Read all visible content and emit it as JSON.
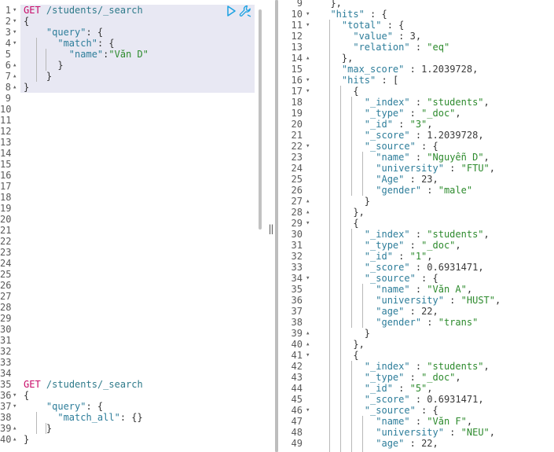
{
  "left_editor": {
    "lines": [
      {
        "n": "1",
        "fold": "▾",
        "parts": [
          [
            "m",
            "GET"
          ],
          [
            "p",
            " "
          ],
          [
            "u",
            "/students/_search"
          ]
        ]
      },
      {
        "n": "2",
        "fold": "▾",
        "parts": [
          [
            "p",
            "{"
          ]
        ]
      },
      {
        "n": "3",
        "fold": "▾",
        "parts": [
          [
            "p",
            "    "
          ],
          [
            "k",
            "\"query\""
          ],
          [
            "p",
            ": {"
          ]
        ]
      },
      {
        "n": "4",
        "fold": "▾",
        "parts": [
          [
            "p",
            "      "
          ],
          [
            "k",
            "\"match\""
          ],
          [
            "p",
            ": {"
          ]
        ]
      },
      {
        "n": "5",
        "fold": "",
        "parts": [
          [
            "p",
            "        "
          ],
          [
            "k",
            "\"name\""
          ],
          [
            "p",
            ":"
          ],
          [
            "s",
            "\"Văn D\""
          ]
        ]
      },
      {
        "n": "6",
        "fold": "▴",
        "parts": [
          [
            "p",
            "      }"
          ]
        ]
      },
      {
        "n": "7",
        "fold": "▴",
        "parts": [
          [
            "p",
            "    }"
          ]
        ]
      },
      {
        "n": "8",
        "fold": "▴",
        "parts": [
          [
            "p",
            "}"
          ]
        ]
      },
      {
        "n": "9",
        "fold": "",
        "parts": []
      },
      {
        "n": "10",
        "fold": "",
        "parts": []
      },
      {
        "n": "11",
        "fold": "",
        "parts": []
      },
      {
        "n": "12",
        "fold": "",
        "parts": []
      },
      {
        "n": "13",
        "fold": "",
        "parts": []
      },
      {
        "n": "14",
        "fold": "",
        "parts": []
      },
      {
        "n": "15",
        "fold": "",
        "parts": []
      },
      {
        "n": "16",
        "fold": "",
        "parts": []
      },
      {
        "n": "17",
        "fold": "",
        "parts": []
      },
      {
        "n": "18",
        "fold": "",
        "parts": []
      },
      {
        "n": "19",
        "fold": "",
        "parts": []
      },
      {
        "n": "20",
        "fold": "",
        "parts": []
      },
      {
        "n": "21",
        "fold": "",
        "parts": []
      },
      {
        "n": "22",
        "fold": "",
        "parts": []
      },
      {
        "n": "23",
        "fold": "",
        "parts": []
      },
      {
        "n": "24",
        "fold": "",
        "parts": []
      },
      {
        "n": "25",
        "fold": "",
        "parts": []
      },
      {
        "n": "26",
        "fold": "",
        "parts": []
      },
      {
        "n": "27",
        "fold": "",
        "parts": []
      },
      {
        "n": "28",
        "fold": "",
        "parts": []
      },
      {
        "n": "29",
        "fold": "",
        "parts": []
      },
      {
        "n": "30",
        "fold": "",
        "parts": []
      },
      {
        "n": "31",
        "fold": "",
        "parts": []
      },
      {
        "n": "32",
        "fold": "",
        "parts": []
      },
      {
        "n": "33",
        "fold": "",
        "parts": []
      },
      {
        "n": "34",
        "fold": "",
        "parts": []
      },
      {
        "n": "35",
        "fold": "",
        "parts": [
          [
            "m",
            "GET"
          ],
          [
            "p",
            " "
          ],
          [
            "u",
            "/students/_search"
          ]
        ]
      },
      {
        "n": "36",
        "fold": "▾",
        "parts": [
          [
            "p",
            "{"
          ]
        ]
      },
      {
        "n": "37",
        "fold": "▾",
        "parts": [
          [
            "p",
            "    "
          ],
          [
            "k",
            "\"query\""
          ],
          [
            "p",
            ": {"
          ]
        ]
      },
      {
        "n": "38",
        "fold": "",
        "parts": [
          [
            "p",
            "      "
          ],
          [
            "k",
            "\"match_all\""
          ],
          [
            "p",
            ": {}"
          ]
        ]
      },
      {
        "n": "39",
        "fold": "▴",
        "parts": [
          [
            "p",
            "    }"
          ]
        ]
      },
      {
        "n": "40",
        "fold": "▴",
        "parts": [
          [
            "p",
            "}"
          ]
        ]
      }
    ]
  },
  "right_editor": {
    "lines": [
      {
        "n": "9",
        "fold": "",
        "parts": [
          [
            "p",
            "  },"
          ]
        ]
      },
      {
        "n": "10",
        "fold": "▾",
        "parts": [
          [
            "p",
            "  "
          ],
          [
            "k",
            "\"hits\""
          ],
          [
            "p",
            " : {"
          ]
        ]
      },
      {
        "n": "11",
        "fold": "▾",
        "parts": [
          [
            "p",
            "    "
          ],
          [
            "k",
            "\"total\""
          ],
          [
            "p",
            " : {"
          ]
        ]
      },
      {
        "n": "12",
        "fold": "",
        "parts": [
          [
            "p",
            "      "
          ],
          [
            "k",
            "\"value\""
          ],
          [
            "p",
            " : "
          ],
          [
            "n",
            "3"
          ],
          [
            "p",
            ","
          ]
        ]
      },
      {
        "n": "13",
        "fold": "",
        "parts": [
          [
            "p",
            "      "
          ],
          [
            "k",
            "\"relation\""
          ],
          [
            "p",
            " : "
          ],
          [
            "s",
            "\"eq\""
          ]
        ]
      },
      {
        "n": "14",
        "fold": "▴",
        "parts": [
          [
            "p",
            "    },"
          ]
        ]
      },
      {
        "n": "15",
        "fold": "",
        "parts": [
          [
            "p",
            "    "
          ],
          [
            "k",
            "\"max_score\""
          ],
          [
            "p",
            " : "
          ],
          [
            "n",
            "1.2039728"
          ],
          [
            "p",
            ","
          ]
        ]
      },
      {
        "n": "16",
        "fold": "▾",
        "parts": [
          [
            "p",
            "    "
          ],
          [
            "k",
            "\"hits\""
          ],
          [
            "p",
            " : ["
          ]
        ]
      },
      {
        "n": "17",
        "fold": "▾",
        "parts": [
          [
            "p",
            "      {"
          ]
        ]
      },
      {
        "n": "18",
        "fold": "",
        "parts": [
          [
            "p",
            "        "
          ],
          [
            "k",
            "\"_index\""
          ],
          [
            "p",
            " : "
          ],
          [
            "s",
            "\"students\""
          ],
          [
            "p",
            ","
          ]
        ]
      },
      {
        "n": "19",
        "fold": "",
        "parts": [
          [
            "p",
            "        "
          ],
          [
            "k",
            "\"_type\""
          ],
          [
            "p",
            " : "
          ],
          [
            "s",
            "\"_doc\""
          ],
          [
            "p",
            ","
          ]
        ]
      },
      {
        "n": "20",
        "fold": "",
        "parts": [
          [
            "p",
            "        "
          ],
          [
            "k",
            "\"_id\""
          ],
          [
            "p",
            " : "
          ],
          [
            "s",
            "\"3\""
          ],
          [
            "p",
            ","
          ]
        ]
      },
      {
        "n": "21",
        "fold": "",
        "parts": [
          [
            "p",
            "        "
          ],
          [
            "k",
            "\"_score\""
          ],
          [
            "p",
            " : "
          ],
          [
            "n",
            "1.2039728"
          ],
          [
            "p",
            ","
          ]
        ]
      },
      {
        "n": "22",
        "fold": "▾",
        "parts": [
          [
            "p",
            "        "
          ],
          [
            "k",
            "\"_source\""
          ],
          [
            "p",
            " : {"
          ]
        ]
      },
      {
        "n": "23",
        "fold": "",
        "parts": [
          [
            "p",
            "          "
          ],
          [
            "k",
            "\"name\""
          ],
          [
            "p",
            " : "
          ],
          [
            "s",
            "\"Nguyễn D\""
          ],
          [
            "p",
            ","
          ]
        ]
      },
      {
        "n": "24",
        "fold": "",
        "parts": [
          [
            "p",
            "          "
          ],
          [
            "k",
            "\"university\""
          ],
          [
            "p",
            " : "
          ],
          [
            "s",
            "\"FTU\""
          ],
          [
            "p",
            ","
          ]
        ]
      },
      {
        "n": "25",
        "fold": "",
        "parts": [
          [
            "p",
            "          "
          ],
          [
            "k",
            "\"Age\""
          ],
          [
            "p",
            " : "
          ],
          [
            "n",
            "23"
          ],
          [
            "p",
            ","
          ]
        ]
      },
      {
        "n": "26",
        "fold": "",
        "parts": [
          [
            "p",
            "          "
          ],
          [
            "k",
            "\"gender\""
          ],
          [
            "p",
            " : "
          ],
          [
            "s",
            "\"male\""
          ]
        ]
      },
      {
        "n": "27",
        "fold": "▴",
        "parts": [
          [
            "p",
            "        }"
          ]
        ]
      },
      {
        "n": "28",
        "fold": "▴",
        "parts": [
          [
            "p",
            "      },"
          ]
        ]
      },
      {
        "n": "29",
        "fold": "▾",
        "parts": [
          [
            "p",
            "      {"
          ]
        ]
      },
      {
        "n": "30",
        "fold": "",
        "parts": [
          [
            "p",
            "        "
          ],
          [
            "k",
            "\"_index\""
          ],
          [
            "p",
            " : "
          ],
          [
            "s",
            "\"students\""
          ],
          [
            "p",
            ","
          ]
        ]
      },
      {
        "n": "31",
        "fold": "",
        "parts": [
          [
            "p",
            "        "
          ],
          [
            "k",
            "\"_type\""
          ],
          [
            "p",
            " : "
          ],
          [
            "s",
            "\"_doc\""
          ],
          [
            "p",
            ","
          ]
        ]
      },
      {
        "n": "32",
        "fold": "",
        "parts": [
          [
            "p",
            "        "
          ],
          [
            "k",
            "\"_id\""
          ],
          [
            "p",
            " : "
          ],
          [
            "s",
            "\"1\""
          ],
          [
            "p",
            ","
          ]
        ]
      },
      {
        "n": "33",
        "fold": "",
        "parts": [
          [
            "p",
            "        "
          ],
          [
            "k",
            "\"_score\""
          ],
          [
            "p",
            " : "
          ],
          [
            "n",
            "0.6931471"
          ],
          [
            "p",
            ","
          ]
        ]
      },
      {
        "n": "34",
        "fold": "▾",
        "parts": [
          [
            "p",
            "        "
          ],
          [
            "k",
            "\"_source\""
          ],
          [
            "p",
            " : {"
          ]
        ]
      },
      {
        "n": "35",
        "fold": "",
        "parts": [
          [
            "p",
            "          "
          ],
          [
            "k",
            "\"name\""
          ],
          [
            "p",
            " : "
          ],
          [
            "s",
            "\"Văn A\""
          ],
          [
            "p",
            ","
          ]
        ]
      },
      {
        "n": "36",
        "fold": "",
        "parts": [
          [
            "p",
            "          "
          ],
          [
            "k",
            "\"university\""
          ],
          [
            "p",
            " : "
          ],
          [
            "s",
            "\"HUST\""
          ],
          [
            "p",
            ","
          ]
        ]
      },
      {
        "n": "37",
        "fold": "",
        "parts": [
          [
            "p",
            "          "
          ],
          [
            "k",
            "\"age\""
          ],
          [
            "p",
            " : "
          ],
          [
            "n",
            "22"
          ],
          [
            "p",
            ","
          ]
        ]
      },
      {
        "n": "38",
        "fold": "",
        "parts": [
          [
            "p",
            "          "
          ],
          [
            "k",
            "\"gender\""
          ],
          [
            "p",
            " : "
          ],
          [
            "s",
            "\"trans\""
          ]
        ]
      },
      {
        "n": "39",
        "fold": "▴",
        "parts": [
          [
            "p",
            "        }"
          ]
        ]
      },
      {
        "n": "40",
        "fold": "▴",
        "parts": [
          [
            "p",
            "      },"
          ]
        ]
      },
      {
        "n": "41",
        "fold": "▾",
        "parts": [
          [
            "p",
            "      {"
          ]
        ]
      },
      {
        "n": "42",
        "fold": "",
        "parts": [
          [
            "p",
            "        "
          ],
          [
            "k",
            "\"_index\""
          ],
          [
            "p",
            " : "
          ],
          [
            "s",
            "\"students\""
          ],
          [
            "p",
            ","
          ]
        ]
      },
      {
        "n": "43",
        "fold": "",
        "parts": [
          [
            "p",
            "        "
          ],
          [
            "k",
            "\"_type\""
          ],
          [
            "p",
            " : "
          ],
          [
            "s",
            "\"_doc\""
          ],
          [
            "p",
            ","
          ]
        ]
      },
      {
        "n": "44",
        "fold": "",
        "parts": [
          [
            "p",
            "        "
          ],
          [
            "k",
            "\"_id\""
          ],
          [
            "p",
            " : "
          ],
          [
            "s",
            "\"5\""
          ],
          [
            "p",
            ","
          ]
        ]
      },
      {
        "n": "45",
        "fold": "",
        "parts": [
          [
            "p",
            "        "
          ],
          [
            "k",
            "\"_score\""
          ],
          [
            "p",
            " : "
          ],
          [
            "n",
            "0.6931471"
          ],
          [
            "p",
            ","
          ]
        ]
      },
      {
        "n": "46",
        "fold": "▾",
        "parts": [
          [
            "p",
            "        "
          ],
          [
            "k",
            "\"_source\""
          ],
          [
            "p",
            " : {"
          ]
        ]
      },
      {
        "n": "47",
        "fold": "",
        "parts": [
          [
            "p",
            "          "
          ],
          [
            "k",
            "\"name\""
          ],
          [
            "p",
            " : "
          ],
          [
            "s",
            "\"Văn F\""
          ],
          [
            "p",
            ","
          ]
        ]
      },
      {
        "n": "48",
        "fold": "",
        "parts": [
          [
            "p",
            "          "
          ],
          [
            "k",
            "\"university\""
          ],
          [
            "p",
            " : "
          ],
          [
            "s",
            "\"NEU\""
          ],
          [
            "p",
            ","
          ]
        ]
      },
      {
        "n": "49",
        "fold": "",
        "parts": [
          [
            "p",
            "          "
          ],
          [
            "k",
            "\"age\""
          ],
          [
            "p",
            " : "
          ],
          [
            "n",
            "22"
          ],
          [
            "p",
            ","
          ]
        ]
      }
    ]
  },
  "toolbar": {
    "run_icon": "play-icon",
    "settings_icon": "wrench-icon",
    "accent": "#1ba1e2"
  },
  "colors": {
    "method": "#c80a68",
    "url": "#2e7a8a",
    "key": "#2d7d9a",
    "string": "#2c8a2c",
    "highlight": "#e8e8f3"
  }
}
